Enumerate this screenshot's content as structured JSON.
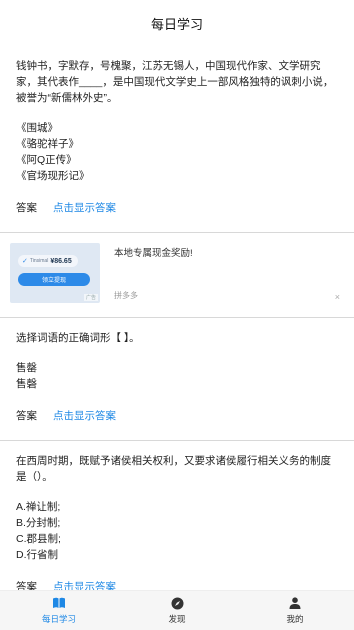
{
  "header": {
    "title": "每日学习"
  },
  "questions": [
    {
      "text": "钱钟书，字默存，号槐聚，江苏无锡人，中国现代作家、文学研究家，其代表作____，是中国现代文学史上一部风格独特的讽刺小说，被誉为“新儒林外史”。",
      "options": [
        "《围城》",
        "《骆驼祥子》",
        "《阿Q正传》",
        "《官场现形记》"
      ],
      "answer_label": "答案",
      "show_answer": "点击显示答案"
    },
    {
      "text": "选择词语的正确词形【 】。",
      "options": [
        "售罄",
        "售磬"
      ],
      "answer_label": "答案",
      "show_answer": "点击显示答案"
    },
    {
      "text": "在西周时期，既赋予诸侯相关权利，又要求诸侯履行相关义务的制度是（）。",
      "options": [
        "A.禅让制;",
        "B.分封制;",
        "C.郡县制;",
        "D.行省制"
      ],
      "answer_label": "答案",
      "show_answer": "点击显示答案"
    }
  ],
  "ad": {
    "title": "本地专属现金奖励!",
    "source": "拼多多",
    "close": "×",
    "thumb": {
      "check": "✓",
      "small_text": "Tinsimal",
      "amount": "¥86.65",
      "button": "领立提现",
      "tag": "广告"
    }
  },
  "tabs": [
    {
      "label": "每日学习",
      "icon": "book-icon",
      "active": true
    },
    {
      "label": "发现",
      "icon": "compass-icon",
      "active": false
    },
    {
      "label": "我的",
      "icon": "person-icon",
      "active": false
    }
  ],
  "colors": {
    "accent": "#1e88e5",
    "tab_bar_bg": "#f6f6f6",
    "divider": "#d8d8d8"
  }
}
